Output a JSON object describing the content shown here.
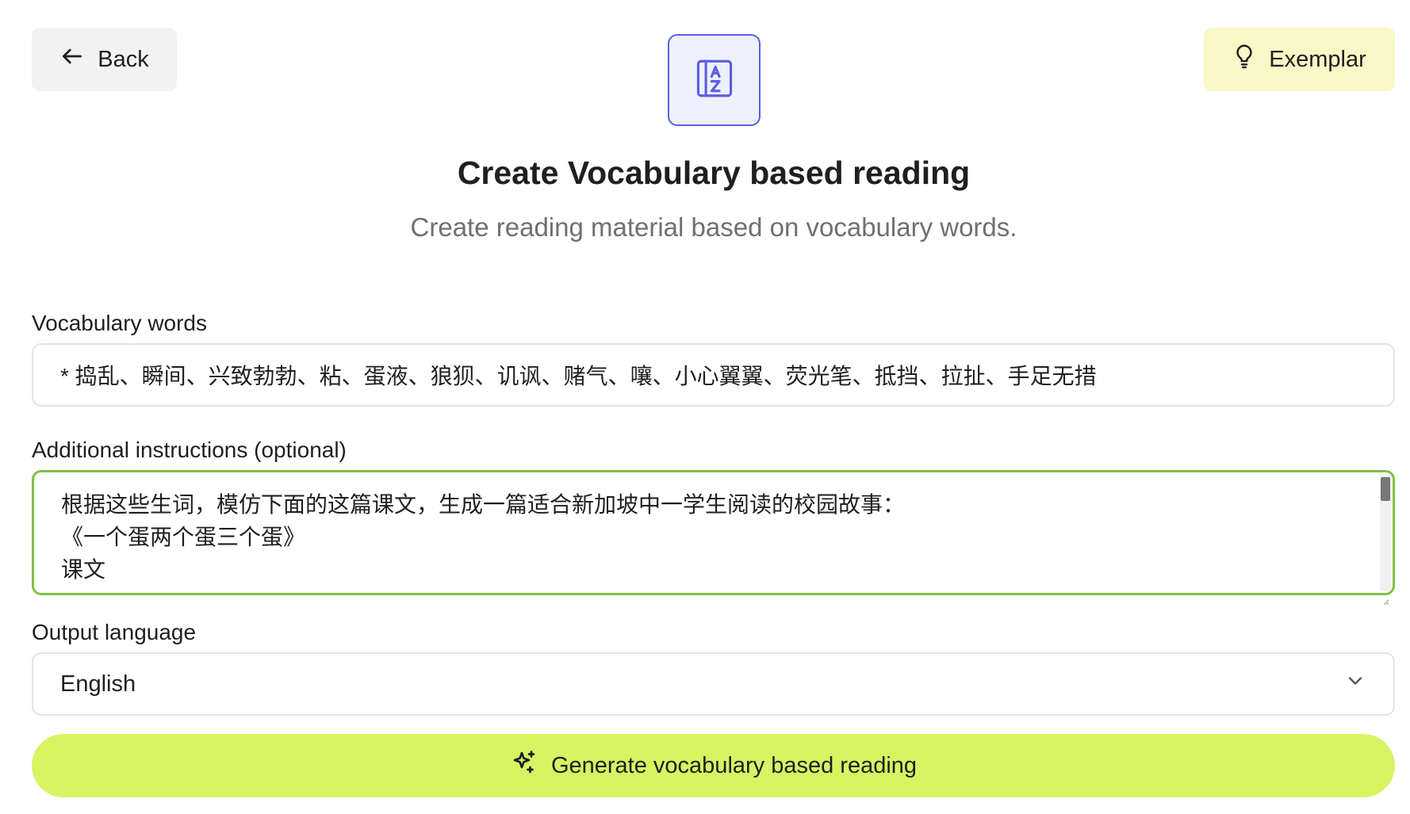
{
  "header": {
    "back_label": "Back",
    "back_icon": "arrow-left-icon",
    "exemplar_label": "Exemplar",
    "exemplar_icon": "lightbulb-icon",
    "logo_icon": "az-dictionary-icon"
  },
  "page": {
    "title": "Create Vocabulary based reading",
    "subtitle": "Create reading material based on vocabulary words."
  },
  "form": {
    "vocab_label": "Vocabulary words",
    "vocab_value": "*  捣乱、瞬间、兴致勃勃、粘、蛋液、狼狈、讥讽、赌气、嚷、小心翼翼、荧光笔、抵挡、拉扯、手足无措",
    "instructions_label": "Additional instructions (optional)",
    "instructions_lines": [
      "根据这些生词，模仿下面的这篇课文，生成一篇适合新加坡中一学生阅读的校园故事：",
      "《一个蛋两个蛋三个蛋》",
      "课文"
    ],
    "language_label": "Output language",
    "language_value": "English",
    "language_icon": "chevron-down-icon"
  },
  "actions": {
    "generate_label": "Generate vocabulary based reading",
    "generate_icon": "sparkles-icon"
  },
  "colors": {
    "logo_accent": "#5b5fe0",
    "logo_bg": "#eef0fd",
    "exemplar_bg": "#fbf7c6",
    "focus_border": "#7dc143",
    "generate_bg": "#d8f463"
  }
}
